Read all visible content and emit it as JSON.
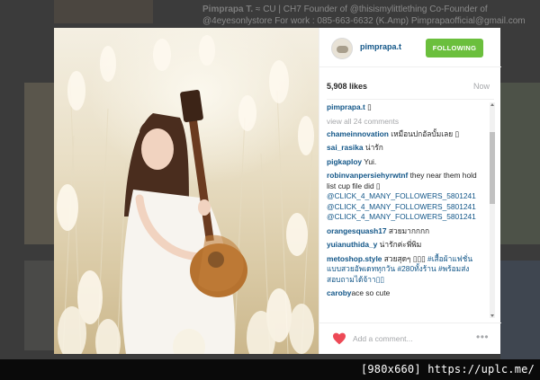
{
  "background": {
    "header_name": "Pimprapa T.",
    "header_line1": "≈ CU | CH7 Founder of @thisismylittlething Co-Founder of",
    "header_line2": "@4eyesonlystore For work : 085-663-6632 (K.Amp) Pimprapaofficial@gmail.com"
  },
  "post": {
    "username": "pimprapa.t",
    "follow_label": "FOLLOWING",
    "likes": "5,908 likes",
    "timeago": "Now",
    "caption_user": "pimprapa.t",
    "caption_text": "▯",
    "view_all": "view all 24 comments",
    "comments": [
      {
        "user": "chameinnovation",
        "text": " เหมือนปกอัลบั้มเลย ▯"
      },
      {
        "user": "sai_rasika",
        "text": " น่ารัก"
      },
      {
        "user": "pigkaploy",
        "text": " Yui."
      },
      {
        "user": "robinvanpersiehyrwtnf",
        "text": " they near them hold list cup file did ▯",
        "mentions": [
          "@CLICK_4_MANY_FOLLOWERS_5801241",
          "@CLICK_4_MANY_FOLLOWERS_5801241",
          "@CLICK_4_MANY_FOLLOWERS_5801241"
        ]
      },
      {
        "user": "orangesquash17",
        "text": " สวยมากกกก"
      },
      {
        "user": "yuianuthida_y",
        "text": " น่ารักค่ะพี่พิม"
      },
      {
        "user": "metoshop.style",
        "text": " สวยสุดๆ ▯▯▯",
        "mentions_inline": "#เสื้อผ้าแฟชั่นแบบสวยอัพเดททุกวัน #280ทั้งร้าน #พร้อมส่งสอบถามได้จ้าา▯▯"
      },
      {
        "user": "caroby",
        "text": "ace so cute"
      }
    ],
    "add_comment_placeholder": "Add a comment...",
    "more_glyph": "•••"
  },
  "watermark": "[980x660] https://uplc.me/",
  "colors": {
    "accent_link": "#125688",
    "follow_green": "#6bbf3d",
    "heart_red": "#ed4956",
    "muted": "#a5a7aa"
  },
  "icons": [
    "heart-icon",
    "more-options-icon",
    "avatar"
  ]
}
